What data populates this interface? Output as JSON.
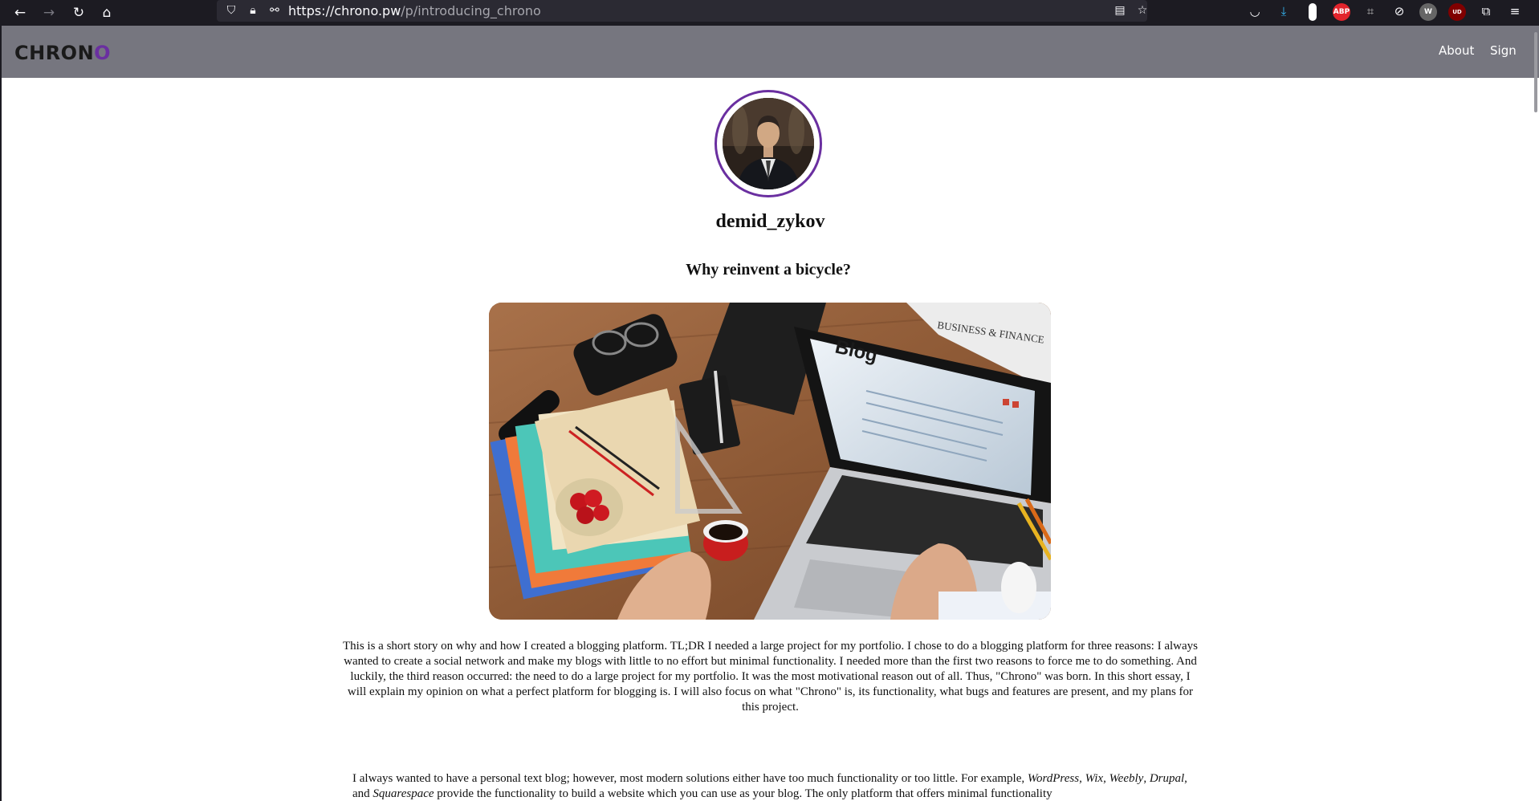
{
  "browser": {
    "url_host": "https://chrono.pw",
    "url_path": "/p/introducing_chrono",
    "nav_icons": [
      "back-icon",
      "forward-icon",
      "reload-icon",
      "home-icon"
    ],
    "extensions": [
      "pocket-icon",
      "downloads-icon",
      "extension-icon",
      "adblock-icon",
      "crop-icon",
      "sync-icon",
      "wikipedia-icon",
      "ublock-icon",
      "extensions-icon",
      "menu-icon"
    ],
    "ext_labels": {
      "abp": "ABP",
      "w": "W",
      "ud": "UD"
    }
  },
  "site": {
    "logo_main": "CHRON",
    "logo_accent": "O",
    "logo_accent_color": "#6a2fa0",
    "nav": {
      "about": "About",
      "sign": "Sign"
    }
  },
  "post": {
    "author": "demid_zykov",
    "title": "Why reinvent a bicycle?",
    "intro": "This is a short story on why and how I created a blogging platform. TL;DR I needed a large project for my portfolio. I chose to do a blogging platform for three reasons: I always wanted to create a social network and make my blogs with little to no effort but minimal functionality. I needed more than the first two reasons to force me to do something. And luckily, the third reason occurred: the need to do a large project for my portfolio. It was the most motivational reason out of all. Thus, \"Chrono\" was born. In this short essay, I will explain my opinion on what a perfect platform for blogging is. I will also focus on what \"Chrono\" is, its functionality, what bugs and features are present, and my plans for this project.",
    "body_start": "I always wanted to have a personal text blog; however, most modern solutions either have too much functionality or too little. For example, ",
    "body_italic_1": "WordPress",
    "body_sep_1": ", ",
    "body_italic_2": "Wix",
    "body_sep_2": ", ",
    "body_italic_3": "Weebly",
    "body_sep_3": ", ",
    "body_italic_4": "Drupal",
    "body_sep_4": ", and ",
    "body_italic_5": "Squarespace",
    "body_end": " provide the functionality to build a website which you can use as your blog. The only platform that offers minimal functionality"
  },
  "hero_image": {
    "label": "Blog",
    "headline": "BUSINESS & FINANCE"
  }
}
